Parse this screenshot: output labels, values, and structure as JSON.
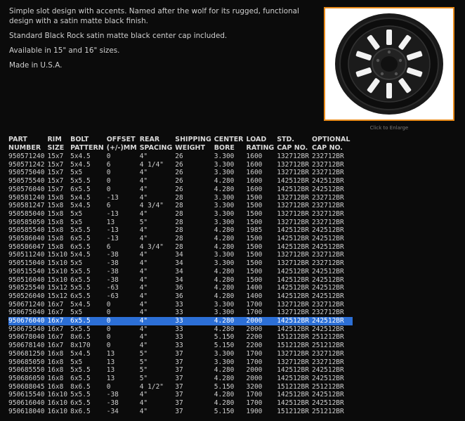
{
  "intro": [
    "Simple slot design with accents.  Named after the wolf for its rugged, functional design with a satin matte black finish.",
    "Standard Black Rock satin matte black center cap included.",
    "Available in 15\" and 16\" sizes.",
    "Made in U.S.A."
  ],
  "image": {
    "caption": "Click to Enlarge",
    "icon": "wheel-image"
  },
  "table": {
    "headers": [
      [
        "PART",
        "NUMBER"
      ],
      [
        "RIM",
        "SIZE"
      ],
      [
        "BOLT",
        "PATTERN"
      ],
      [
        "OFFSET",
        "(+/-)MM"
      ],
      [
        "REAR",
        "SPACING"
      ],
      [
        "SHIPPING",
        "WEIGHT"
      ],
      [
        "CENTER",
        "BORE"
      ],
      [
        "LOAD",
        "RATING"
      ],
      [
        "STD.",
        "CAP NO."
      ],
      [
        "OPTIONAL",
        "CAP NO."
      ]
    ],
    "selected_row": 20,
    "rows": [
      [
        "950571240",
        "15x7",
        "5x4.5",
        "0",
        "4\"",
        "26",
        "3.300",
        "1600",
        "132712BR",
        "232712BR"
      ],
      [
        "950571242",
        "15x7",
        "5x4.5",
        "6",
        "4 1/4\"",
        "26",
        "3.300",
        "1600",
        "132712BR",
        "232712BR"
      ],
      [
        "950575040",
        "15x7",
        "5x5",
        "0",
        "4\"",
        "26",
        "3.300",
        "1600",
        "132712BR",
        "232712BR"
      ],
      [
        "950575540",
        "15x7",
        "5x5.5",
        "0",
        "4\"",
        "26",
        "4.280",
        "1600",
        "142512BR",
        "242512BR"
      ],
      [
        "950576040",
        "15x7",
        "6x5.5",
        "0",
        "4\"",
        "26",
        "4.280",
        "1600",
        "142512BR",
        "242512BR"
      ],
      [
        "950581240",
        "15x8",
        "5x4.5",
        "-13",
        "4\"",
        "28",
        "3.300",
        "1500",
        "132712BR",
        "232712BR"
      ],
      [
        "950581247",
        "15x8",
        "5x4.5",
        "6",
        "4 3/4\"",
        "28",
        "3.300",
        "1500",
        "132712BR",
        "232712BR"
      ],
      [
        "950585040",
        "15x8",
        "5x5",
        "-13",
        "4\"",
        "28",
        "3.300",
        "1500",
        "132712BR",
        "232712BR"
      ],
      [
        "950585050",
        "15x8",
        "5x5",
        "13",
        "5\"",
        "28",
        "3.300",
        "1500",
        "132712BR",
        "232712BR"
      ],
      [
        "950585540",
        "15x8",
        "5x5.5",
        "-13",
        "4\"",
        "28",
        "4.280",
        "1985",
        "142512BR",
        "242512BR"
      ],
      [
        "950586040",
        "15x8",
        "6x5.5",
        "-13",
        "4\"",
        "28",
        "4.280",
        "1500",
        "142512BR",
        "242512BR"
      ],
      [
        "950586047",
        "15x8",
        "6x5.5",
        "6",
        "4 3/4\"",
        "28",
        "4.280",
        "1500",
        "142512BR",
        "242512BR"
      ],
      [
        "950511240",
        "15x10",
        "5x4.5",
        "-38",
        "4\"",
        "34",
        "3.300",
        "1500",
        "132712BR",
        "232712BR"
      ],
      [
        "950515040",
        "15x10",
        "5x5",
        "-38",
        "4\"",
        "34",
        "3.300",
        "1500",
        "132712BR",
        "232712BR"
      ],
      [
        "950515540",
        "15x10",
        "5x5.5",
        "-38",
        "4\"",
        "34",
        "4.280",
        "1500",
        "142512BR",
        "242512BR"
      ],
      [
        "950516040",
        "15x10",
        "6x5.5",
        "-38",
        "4\"",
        "34",
        "4.280",
        "1500",
        "142512BR",
        "242512BR"
      ],
      [
        "950525540",
        "15x12",
        "5x5.5",
        "-63",
        "4\"",
        "36",
        "4.280",
        "1400",
        "142512BR",
        "242512BR"
      ],
      [
        "950526040",
        "15x12",
        "6x5.5",
        "-63",
        "4\"",
        "36",
        "4.280",
        "1400",
        "142512BR",
        "242512BR"
      ],
      [
        "950671240",
        "16x7",
        "5x4.5",
        "0",
        "4\"",
        "33",
        "3.300",
        "1700",
        "132712BR",
        "232712BR"
      ],
      [
        "950675040",
        "16x7",
        "5x5",
        "0",
        "4\"",
        "33",
        "3.300",
        "1700",
        "132712BR",
        "232712BR"
      ],
      [
        "950676040",
        "16x7",
        "6x5.5",
        "0",
        "4\"",
        "33",
        "4.280",
        "2000",
        "142512BR",
        "242512BR"
      ],
      [
        "950675540",
        "16x7",
        "5x5.5",
        "0",
        "4\"",
        "33",
        "4.280",
        "2000",
        "142512BR",
        "242512BR"
      ],
      [
        "950678040",
        "16x7",
        "8x6.5",
        "0",
        "4\"",
        "33",
        "5.150",
        "2200",
        "151212BR",
        "251212BR"
      ],
      [
        "950678140",
        "16x7",
        "8x170",
        "0",
        "4\"",
        "33",
        "5.150",
        "2200",
        "151212BR",
        "251212BR"
      ],
      [
        "950681250",
        "16x8",
        "5x4.5",
        "13",
        "5\"",
        "37",
        "3.300",
        "1700",
        "132712BR",
        "232712BR"
      ],
      [
        "950685050",
        "16x8",
        "5x5",
        "13",
        "5\"",
        "37",
        "3.300",
        "1700",
        "132712BR",
        "232712BR"
      ],
      [
        "950685550",
        "16x8",
        "5x5.5",
        "13",
        "5\"",
        "37",
        "4.280",
        "2000",
        "142512BR",
        "242512BR"
      ],
      [
        "950686050",
        "16x8",
        "6x5.5",
        "13",
        "5\"",
        "37",
        "4.280",
        "2000",
        "142512BR",
        "242512BR"
      ],
      [
        "950688045",
        "16x8",
        "8x6.5",
        "0",
        "4 1/2\"",
        "37",
        "5.150",
        "3200",
        "151212BR",
        "251212BR"
      ],
      [
        "950615540",
        "16x10",
        "5x5.5",
        "-38",
        "4\"",
        "37",
        "4.280",
        "1700",
        "142512BR",
        "242512BR"
      ],
      [
        "950616040",
        "16x10",
        "6x5.5",
        "-38",
        "4\"",
        "37",
        "4.280",
        "1700",
        "142512BR",
        "242512BR"
      ],
      [
        "950618040",
        "16x10",
        "8x6.5",
        "-34",
        "4\"",
        "37",
        "5.150",
        "1900",
        "151212BR",
        "251212BR"
      ]
    ]
  }
}
